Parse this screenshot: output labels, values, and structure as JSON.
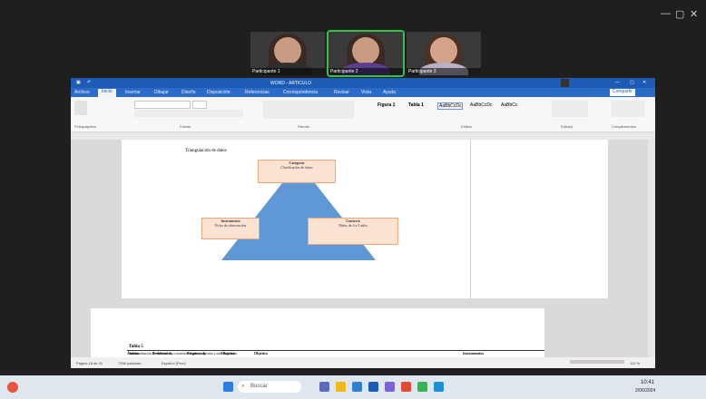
{
  "meeting": {
    "participants": [
      {
        "name": "Participante 1"
      },
      {
        "name": "Participante 2"
      },
      {
        "name": "Participante 3"
      }
    ],
    "window_controls": [
      "—",
      "▢",
      "✕"
    ]
  },
  "word": {
    "title": "WORD - ARTICULO",
    "tabs": [
      "Archivo",
      "Inicio",
      "Insertar",
      "Dibujar",
      "Diseño",
      "Disposición",
      "Referencias",
      "Correspondencia",
      "Revisar",
      "Vista",
      "Ayuda"
    ],
    "active_tab": "Inicio",
    "ribbon_groups": [
      "Portapapeles",
      "Fuente",
      "Párrafo",
      "Estilos",
      "Edición",
      "Complementos"
    ],
    "styles": [
      "Figura 1",
      "Tabla 1",
      "AaBbCcDc",
      "AaBbCcDc",
      "AaBbCc"
    ],
    "share_label": "Compartir",
    "doc": {
      "heading_text": "Triangulación de datos",
      "box_top_title": "Categoría",
      "box_top_sub": "Clasificación de datos",
      "box_left_title": "Instrumento",
      "box_left_sub": "Ficha de observación",
      "box_right_title": "Contexto",
      "box_right_sub": "Niños de 4 a 5 años",
      "table_title": "Tabla 5",
      "table_caption": "Sistematización de variables y construcción de categorías y subcategorías",
      "table_headers": [
        "Ámbito",
        "Problema de",
        "Pregunta de",
        "Objetivo",
        "Objetivo",
        "Instrumentos"
      ]
    },
    "status": {
      "page": "Página 18 de 31",
      "words": "7256 palabras",
      "language": "Español (Perú)",
      "zoom": "110 %"
    }
  },
  "taskbar": {
    "search_label": "Buscar",
    "time": "10:41",
    "date": "2/06/2024"
  }
}
